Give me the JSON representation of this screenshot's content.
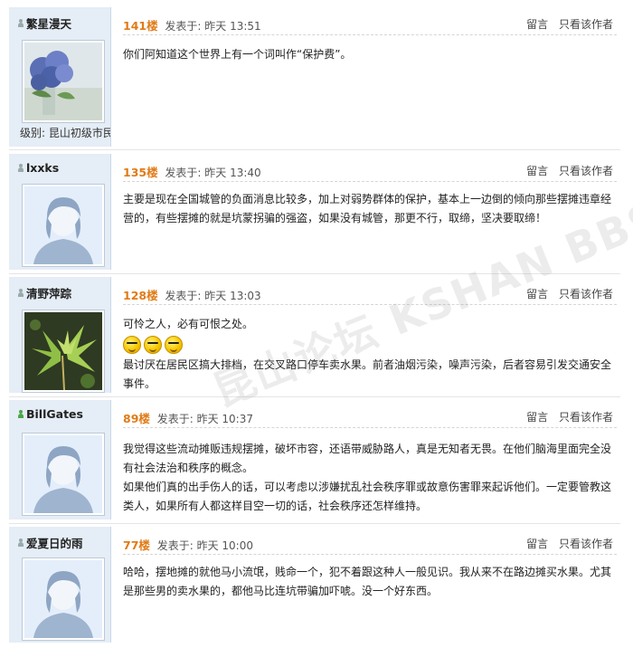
{
  "posts": [
    {
      "username": "繁星漫天",
      "online": false,
      "avatar": "hydrangea-photo",
      "level": "级别: 昆山初级市民",
      "floor": "141楼",
      "posted": "发表于: 昨天 13:51",
      "action_reply": "留言",
      "action_author": "只看该作者",
      "content": [
        "你们阿知道这个世界上有一个词叫作“保护费”。"
      ]
    },
    {
      "username": "lxxks",
      "online": false,
      "avatar": "default-avatar",
      "floor": "135楼",
      "posted": "发表于: 昨天 13:40",
      "action_reply": "留言",
      "action_author": "只看该作者",
      "content": [
        "主要是现在全国城管的负面消息比较多，加上对弱势群体的保护，基本上一边倒的倾向那些摆摊违章经营的，有些摆摊的就是坑蒙拐骗的强盗，如果没有城管，那更不行，取缔，坚决要取缔！"
      ]
    },
    {
      "username": "清野萍踪",
      "online": false,
      "avatar": "maple-leaves-photo",
      "floor": "128楼",
      "posted": "发表于: 昨天 13:03",
      "action_reply": "留言",
      "action_author": "只看该作者",
      "content": [
        "可怜之人，必有可恨之处。",
        "最讨厌在居民区搞大排档，在交叉路口停车卖水果。前者油烟污染，噪声污染，后者容易引发交通安全事件。"
      ],
      "emoticons": [
        "smile-face-icon",
        "smile-face-icon",
        "smile-face-icon"
      ]
    },
    {
      "username": "BillGates",
      "online": true,
      "avatar": "default-avatar",
      "floor": "89楼",
      "posted": "发表于: 昨天 10:37",
      "action_reply": "留言",
      "action_author": "只看该作者",
      "content": [
        "我觉得这些流动摊贩违规摆摊，破坏市容，还语带威胁路人，真是无知者无畏。在他们脑海里面完全没有社会法治和秩序的概念。",
        "如果他们真的出手伤人的话，可以考虑以涉嫌扰乱社会秩序罪或故意伤害罪来起诉他们。一定要管教这类人，如果所有人都这样目空一切的话，社会秩序还怎样维持。"
      ]
    },
    {
      "username": "爱夏日的雨",
      "online": false,
      "avatar": "default-avatar",
      "floor": "77楼",
      "posted": "发表于: 昨天 10:00",
      "action_reply": "留言",
      "action_author": "只看该作者",
      "content": [
        "哈哈，摆地摊的就他马小流氓，贱命一个，犯不着跟这种人一般见识。我从来不在路边摊买水果。尤其是那些男的卖水果的，都他马比连坑带骗加吓唬。没一个好东西。"
      ]
    }
  ],
  "watermark": "昆山论坛 KSHAN BBS"
}
